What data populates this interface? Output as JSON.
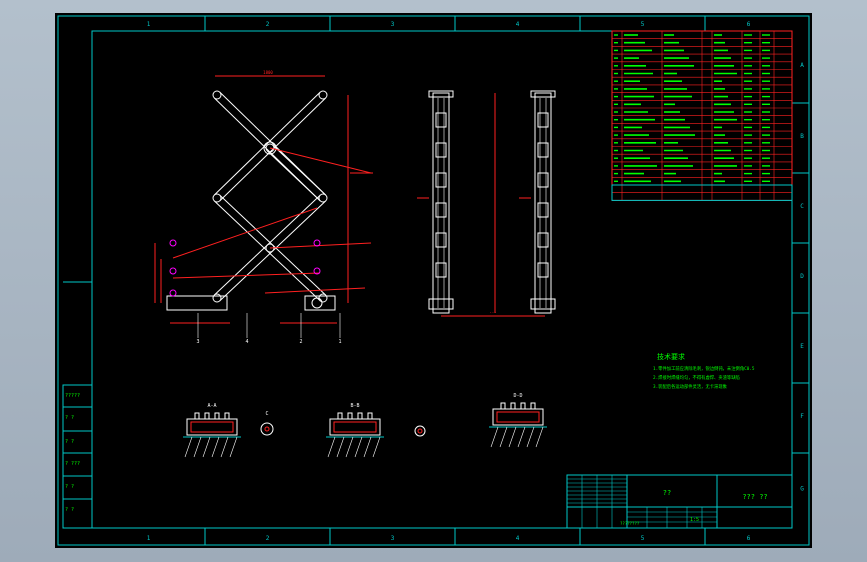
{
  "colors": {
    "background": "#000000",
    "frame": "#00c8c8",
    "lines": "#ffffff",
    "dimensions": "#ff2020",
    "text": "#00ff00",
    "hatch": "#ff00ff",
    "window": "#a9b6c3"
  },
  "frame": {
    "columns": [
      "1",
      "2",
      "3",
      "4",
      "5",
      "6"
    ],
    "rows": [
      "A",
      "B",
      "C",
      "D",
      "E",
      "F",
      "G"
    ]
  },
  "title_block": {
    "main_title": "??",
    "drawing_no": "??? ??",
    "scale": "1:5",
    "stamp": "????????"
  },
  "left_strip": [
    "?????",
    "? ?",
    "? ?",
    "? ???",
    "? ?",
    "? ?"
  ],
  "technical_requirements": {
    "heading": "技术要求",
    "lines": [
      "1.零件加工前应清除毛刺，锐边倒钝，未注倒角C0.5",
      "2.焊接时焊缝均匀，不得有虚焊、夹渣等缺陷",
      "3.装配后各运动部件灵活，无卡滞现象"
    ]
  },
  "section_labels": [
    "A-A",
    "B-B",
    "D-D",
    "C"
  ],
  "views": {
    "main": "scissor-lift-front",
    "side_left": "side-elevation",
    "side_right": "side-elevation-2"
  }
}
